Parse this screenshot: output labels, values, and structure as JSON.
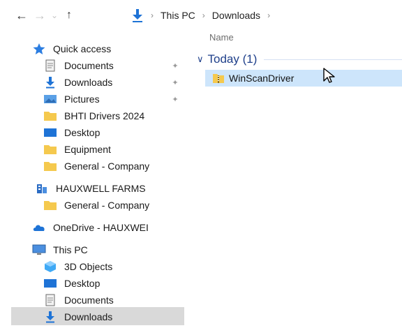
{
  "address_bar": {
    "back_glyph": "←",
    "forward_glyph": "→",
    "recent_glyph": "⌄",
    "up_glyph": "↑",
    "separator": "›",
    "crumbs": [
      "This PC",
      "Downloads"
    ]
  },
  "content": {
    "column_name": "Name",
    "group_label": "Today (1)",
    "files": [
      {
        "name": "WinScanDriver",
        "icon": "zip-folder-icon"
      }
    ]
  },
  "nav": {
    "quick_access": "Quick access",
    "qa_items": [
      {
        "label": "Documents",
        "icon": "documents-icon",
        "pinned": true
      },
      {
        "label": "Downloads",
        "icon": "downloads-icon",
        "pinned": true
      },
      {
        "label": "Pictures",
        "icon": "pictures-icon",
        "pinned": true
      },
      {
        "label": "BHTI Drivers 2024",
        "icon": "folder-icon",
        "pinned": false
      },
      {
        "label": "Desktop",
        "icon": "desktop-icon",
        "pinned": false
      },
      {
        "label": "Equipment",
        "icon": "folder-icon",
        "pinned": false
      },
      {
        "label": "General - Company",
        "icon": "folder-icon",
        "pinned": false
      }
    ],
    "hauxwell": "HAUXWELL FARMS",
    "hauxwell_items": [
      {
        "label": "General - Company",
        "icon": "folder-icon"
      }
    ],
    "onedrive": "OneDrive - HAUXWEI",
    "this_pc": "This PC",
    "pc_items": [
      {
        "label": "3D Objects",
        "icon": "3d-objects-icon"
      },
      {
        "label": "Desktop",
        "icon": "desktop-icon"
      },
      {
        "label": "Documents",
        "icon": "documents-icon"
      },
      {
        "label": "Downloads",
        "icon": "downloads-icon",
        "selected": true
      }
    ]
  },
  "colors": {
    "accent": "#1e73d6",
    "selection": "#cde5fb",
    "nav_selected": "#d9d9d9",
    "group_text": "#1e3f8a",
    "folder": "#f5c94e"
  }
}
